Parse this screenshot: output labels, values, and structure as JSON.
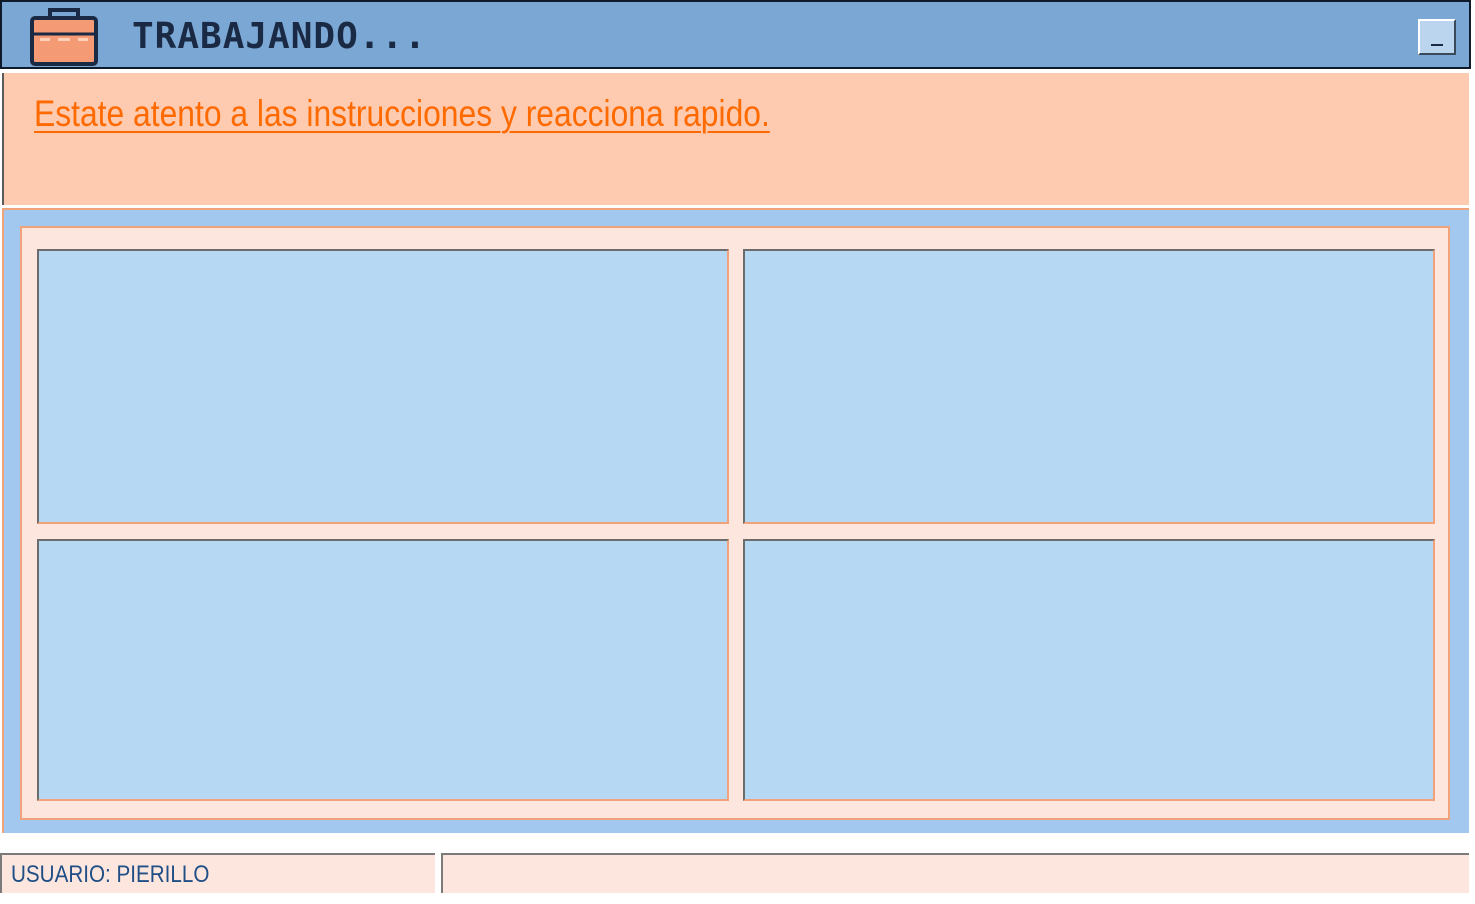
{
  "window": {
    "title": "TRABAJANDO...",
    "icon": "briefcase-icon",
    "minimize_label": "_"
  },
  "instructions": {
    "text": "Estate atento a las instrucciones y reacciona rapido."
  },
  "grid": {
    "cells": [
      "",
      "",
      "",
      ""
    ]
  },
  "status": {
    "user_label": "USUARIO: PIERILLO",
    "message": ""
  },
  "colors": {
    "titlebar": "#7ba7d4",
    "instruction_bg": "#fecbb0",
    "instruction_text": "#ff6a00",
    "game_bg": "#a2c8ef",
    "cell_bg": "#b7d8f2",
    "frame": "#fde6de"
  }
}
